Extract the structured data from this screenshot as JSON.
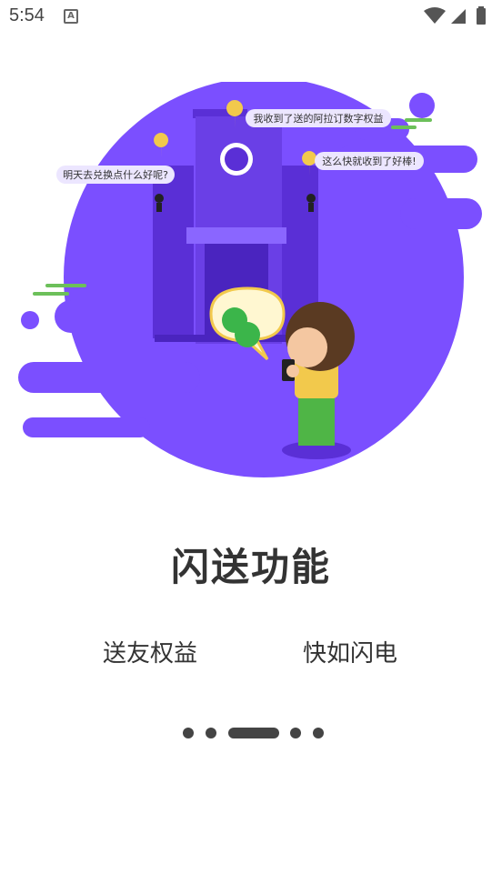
{
  "status": {
    "time": "5:54",
    "notification_icon": "A"
  },
  "hero": {
    "bubble_left": "明天去兑换点什么好呢?",
    "bubble_top": "我收到了送的阿拉订数字权益",
    "bubble_right": "这么快就收到了好棒!"
  },
  "title": "闪送功能",
  "features": [
    "送友权益",
    "快如闪电"
  ],
  "pager": {
    "count": 5,
    "active_index": 2
  },
  "colors": {
    "primary_purple": "#7b4fff",
    "dark_purple": "#5a2fd6",
    "green": "#6cc05a"
  }
}
